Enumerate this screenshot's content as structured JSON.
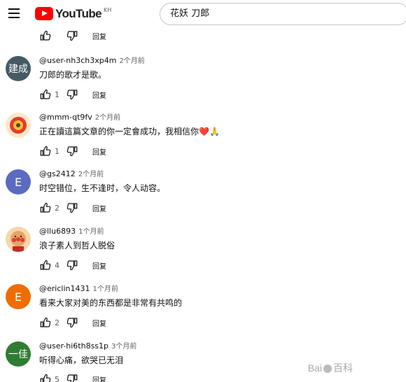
{
  "header": {
    "logo_text": "YouTube",
    "country_code": "KH",
    "search_value": "花妖 刀郎"
  },
  "top_actions": {
    "reply_label": "回复"
  },
  "comments": [
    {
      "avatar_text": "建成",
      "avatar_color": "#455a64",
      "author": "@user-nh3ch3xp4m",
      "time": "2个月前",
      "text": "刀郎的歌才是歌。",
      "likes": "1",
      "reply_label": "回复"
    },
    {
      "avatar_text": "",
      "avatar_color": "#fde7c4",
      "author": "@mmm-qt9fv",
      "time": "2个月前",
      "text": "正在讀這篇文章的你一定會成功，我相信你❤️🙏",
      "likes": "1",
      "reply_label": "回复"
    },
    {
      "avatar_text": "E",
      "avatar_color": "#5c6bc0",
      "author": "@gs2412",
      "time": "2个月前",
      "text": "时空错位，生不逢时，令人动容。",
      "likes": "2",
      "reply_label": "回复"
    },
    {
      "avatar_text": "",
      "avatar_color": "#f6d7a7",
      "author": "@llu6893",
      "time": "1个月前",
      "text": "浪子素人到哲人脱俗",
      "likes": "4",
      "reply_label": "回复"
    },
    {
      "avatar_text": "E",
      "avatar_color": "#ef6c00",
      "author": "@ericlin1431",
      "time": "1个月前",
      "text": "看来大家对美的东西都是非常有共鸣的",
      "likes": "2",
      "reply_label": "回复"
    },
    {
      "avatar_text": "一佳",
      "avatar_color": "#2e7d32",
      "author": "@user-hi6th8ss1p",
      "time": "3个月前",
      "text": "听得心痛，欲哭已无泪",
      "likes": "5",
      "reply_label": "回复"
    }
  ],
  "watermark": {
    "text_left": "Bai",
    "text_right": "百科"
  },
  "icons": {
    "menu": "hamburger-icon",
    "like": "thumb-up-icon",
    "dislike": "thumb-down-icon"
  }
}
